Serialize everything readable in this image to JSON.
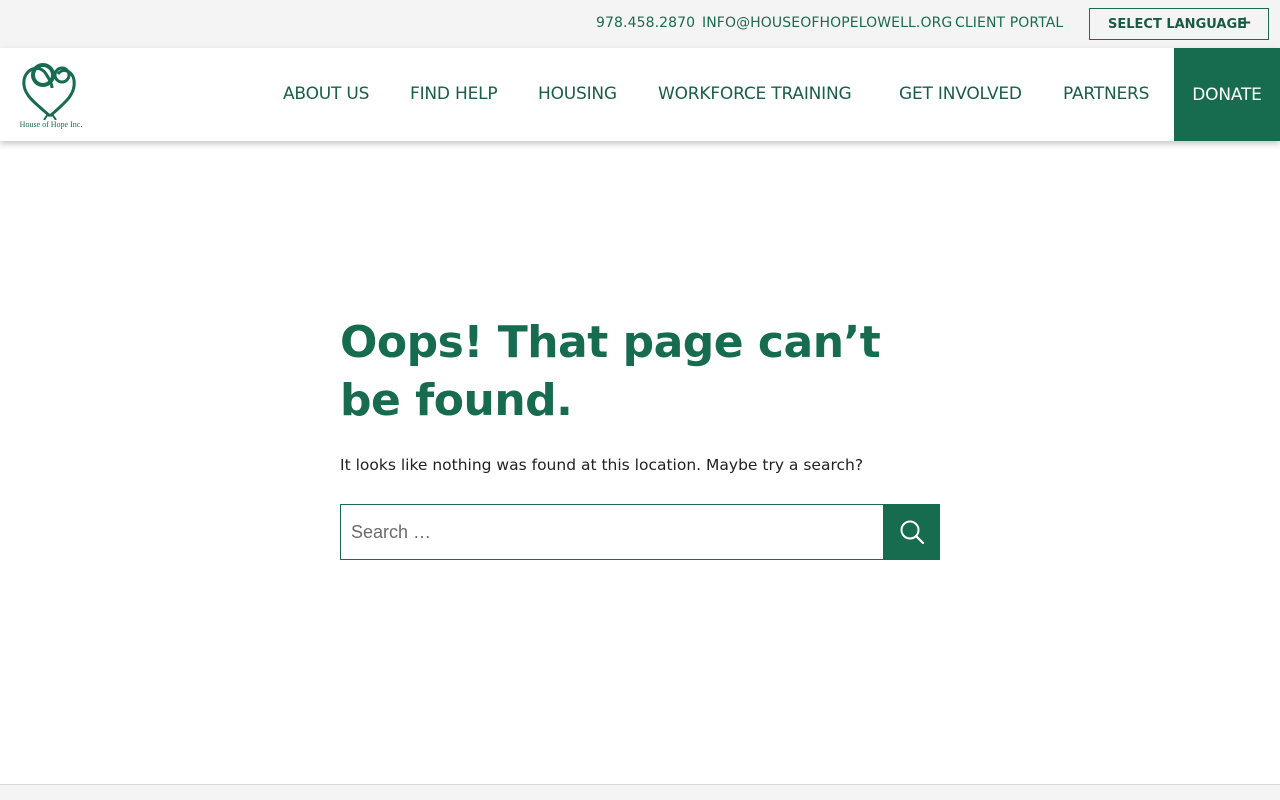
{
  "topbar": {
    "phone": "978.458.2870",
    "email": "INFO@HOUSEOFHOPELOWELL.ORG",
    "portal": "CLIENT PORTAL",
    "language_label": "SELECT LANGUAGE",
    "language_icon": "+"
  },
  "logo": {
    "text": "House of Hope Inc.",
    "icon": "heart-logo-icon"
  },
  "nav": {
    "items": [
      {
        "label": "ABOUT US"
      },
      {
        "label": "FIND HELP"
      },
      {
        "label": "HOUSING"
      },
      {
        "label": "WORKFORCE TRAINING"
      },
      {
        "label": "GET INVOLVED"
      },
      {
        "label": "PARTNERS"
      }
    ],
    "donate_label": "DONATE"
  },
  "main": {
    "title": "Oops! That page can’t be found.",
    "message": "It looks like nothing was found at this location. Maybe try a search?",
    "search_placeholder": "Search …",
    "search_icon": "search-icon"
  },
  "colors": {
    "brand_green": "#176b4f",
    "topbar_bg": "#f4f4f4"
  }
}
